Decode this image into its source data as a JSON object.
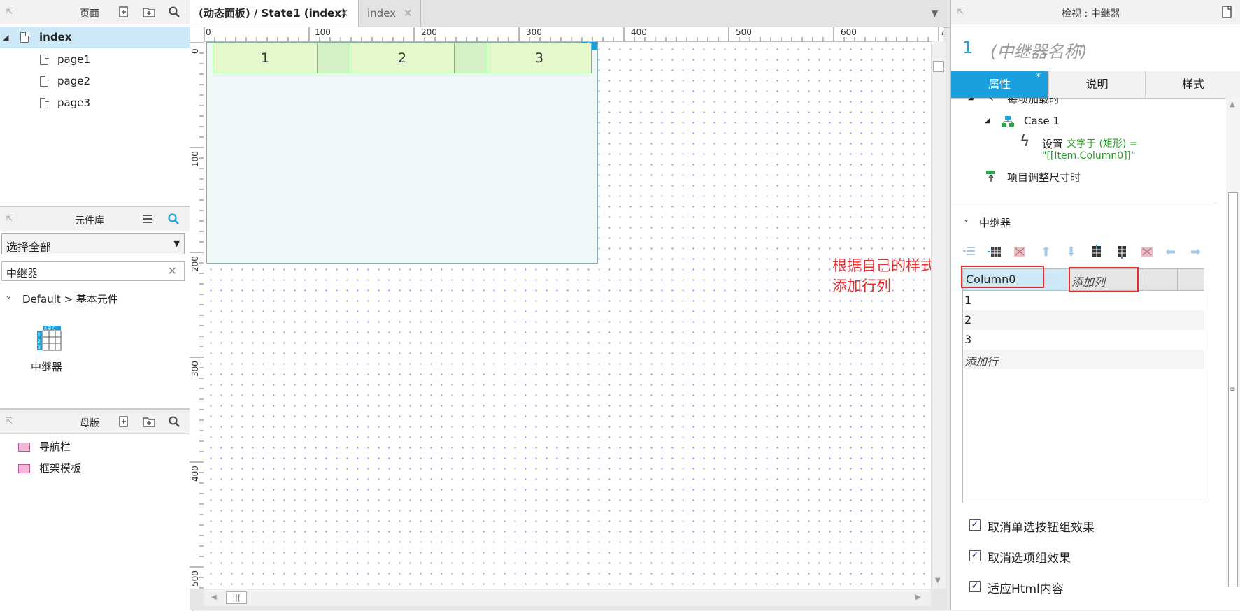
{
  "pages_panel": {
    "title": "页面",
    "items": [
      {
        "label": "index"
      },
      {
        "label": "page1"
      },
      {
        "label": "page2"
      },
      {
        "label": "page3"
      }
    ]
  },
  "library_panel": {
    "title": "元件库",
    "dropdown_value": "选择全部",
    "search_value": "中继器",
    "category": "Default > 基本元件",
    "widget_label": "中继器"
  },
  "masters_panel": {
    "title": "母版",
    "items": [
      {
        "label": "导航栏"
      },
      {
        "label": "框架模板"
      }
    ]
  },
  "canvas": {
    "tabs": [
      {
        "label": "(动态面板) / State1 (index)"
      },
      {
        "label": "index"
      }
    ],
    "ruler_h": [
      "0",
      "100",
      "200",
      "300",
      "400",
      "500",
      "600",
      "7"
    ],
    "ruler_v": [
      "0",
      "100",
      "200",
      "300",
      "400",
      "500"
    ],
    "repeater_items": [
      "1",
      "2",
      "3"
    ]
  },
  "annotation": {
    "line1": "根据自己的样式，",
    "line2": "添加行列",
    "color": "#e03030"
  },
  "inspector": {
    "title": "检视 : 中继器",
    "count": "1",
    "name_placeholder": "(中继器名称)",
    "tabs": [
      {
        "label": "属性"
      },
      {
        "label": "说明"
      },
      {
        "label": "样式"
      }
    ],
    "tab_modified_mark": "*",
    "events": {
      "item_loaded": "每项加载时",
      "case": "Case 1",
      "action_prefix": "设置",
      "action_detail_1": "文字于 (矩形) =",
      "action_detail_2": "\"[[Item.Column0]]\"",
      "item_resize": "项目调整尺寸时"
    },
    "repeater_section": "中继器",
    "dataset": {
      "column": "Column0",
      "add_column": "添加列",
      "rows": [
        "1",
        "2",
        "3"
      ],
      "add_row": "添加行"
    },
    "options": [
      {
        "label": "取消单选按钮组效果",
        "checked": true
      },
      {
        "label": "取消选项组效果",
        "checked": true
      },
      {
        "label": "适应Html内容",
        "checked": true
      }
    ]
  },
  "colors": {
    "accent": "#1aa0dd",
    "selection": "#cde8f6",
    "repeater_fill": "#e4f8cc",
    "repeater_border": "#6cc66c",
    "panel_bg": "#f0f7f8"
  }
}
